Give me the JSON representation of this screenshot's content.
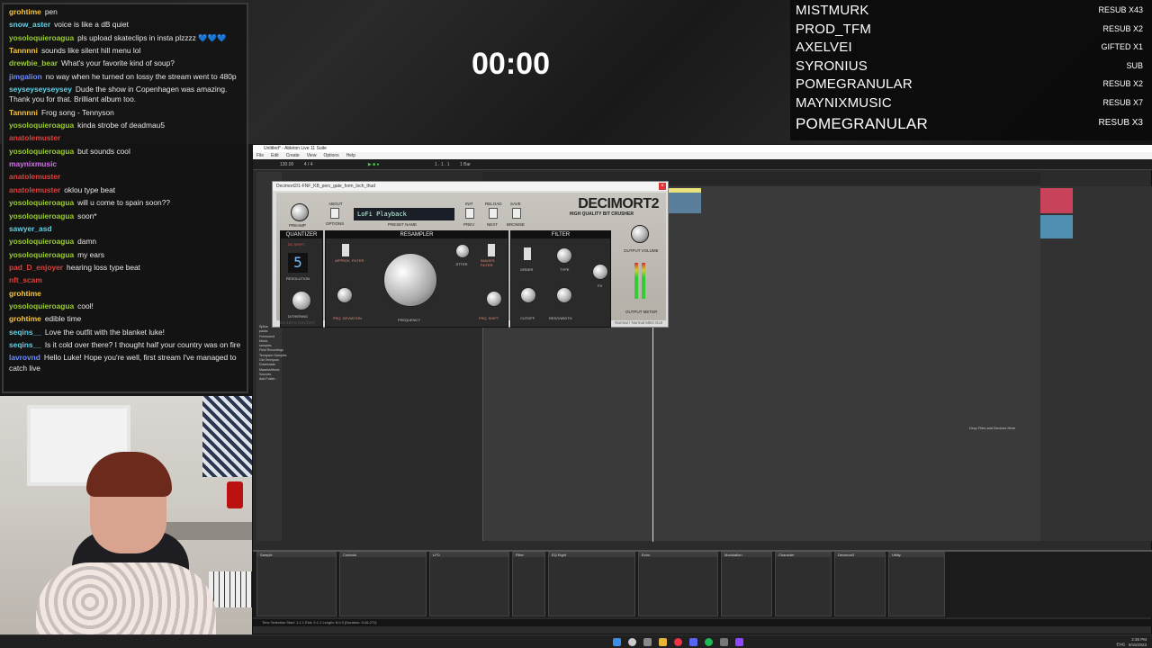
{
  "chat": {
    "messages": [
      {
        "user": "grohtime",
        "text": "pen",
        "color": "#f4c542"
      },
      {
        "user": "snow_aster",
        "text": "voice is like a dB quiet",
        "color": "#5fd3e8"
      },
      {
        "user": "yosoloquieroagua",
        "text": "pls upload skateclips in insta plzzzz 💙💙💙",
        "color": "#9acd32"
      },
      {
        "user": "Tannnni",
        "text": "sounds like silent hill menu lol",
        "color": "#f4c542"
      },
      {
        "user": "drewbie_bear",
        "text": "What's your favorite kind of soup?",
        "color": "#9acd32"
      },
      {
        "user": "jimgalion",
        "text": "no way when he turned on lossy the stream went to 480p",
        "color": "#6b8cff"
      },
      {
        "user": "seyseyseyseysey",
        "text": "Dude the show in Copenhagen was amazing. Thank you for that. Brilliant album too.",
        "color": "#5fd3e8"
      },
      {
        "user": "Tannnni",
        "text": "Frog song - Tennyson",
        "color": "#f4c542"
      },
      {
        "user": "yosoloquieroagua",
        "text": "kinda strobe of deadmau5",
        "color": "#9acd32"
      },
      {
        "user": "anatolemuster",
        "text": "",
        "color": "#e0403a"
      },
      {
        "user": "yosoloquieroagua",
        "text": "but sounds cool",
        "color": "#9acd32"
      },
      {
        "user": "maynixmusic",
        "text": "",
        "color": "#d870f0"
      },
      {
        "user": "anatolemuster",
        "text": "",
        "color": "#e0403a"
      },
      {
        "user": "anatolemuster",
        "text": "oklou type beat",
        "color": "#e0403a"
      },
      {
        "user": "yosoloquieroagua",
        "text": "will u come to spain soon??",
        "color": "#9acd32"
      },
      {
        "user": "yosoloquieroagua",
        "text": "soon*",
        "color": "#9acd32"
      },
      {
        "user": "sawyer_asd",
        "text": "",
        "color": "#5fd3e8"
      },
      {
        "user": "yosoloquieroagua",
        "text": "damn",
        "color": "#9acd32"
      },
      {
        "user": "yosoloquieroagua",
        "text": "my ears",
        "color": "#9acd32"
      },
      {
        "user": "pad_D_enjoyer",
        "text": "hearing loss type beat",
        "color": "#e0403a"
      },
      {
        "user": "nft_scam",
        "text": "",
        "color": "#e0403a"
      },
      {
        "user": "grohtime",
        "text": "",
        "color": "#f4c542"
      },
      {
        "user": "yosoloquieroagua",
        "text": "cool!",
        "color": "#9acd32"
      },
      {
        "user": "grohtime",
        "text": "edible time",
        "color": "#f4c542"
      },
      {
        "user": "seqins__",
        "text": "Love the outfit with the blanket luke!",
        "color": "#5fd3e8"
      },
      {
        "user": "seqins__",
        "text": "Is it cold over there? I thought half your country was on fire",
        "color": "#5fd3e8"
      },
      {
        "user": "lavrovnd",
        "text": "Hello Luke! Hope you're well, first stream I've managed to catch live",
        "color": "#6b8cff"
      }
    ]
  },
  "timer": {
    "value": "00:00"
  },
  "subs": {
    "rows": [
      {
        "name": "MISTMURK",
        "tag": "RESUB X43"
      },
      {
        "name": "PROD_TFM",
        "tag": "RESUB X2"
      },
      {
        "name": "AXELVEI",
        "tag": "GIFTED X1"
      },
      {
        "name": "SYRONIUS",
        "tag": "SUB"
      },
      {
        "name": "POMEGRANULAR",
        "tag": "RESUB X2"
      },
      {
        "name": "MAYNIXMUSIC",
        "tag": "RESUB X7"
      }
    ],
    "latest": {
      "name": "POMEGRANULAR",
      "tag": "RESUB X3"
    }
  },
  "daw": {
    "title": "Untitled* - Ableton Live 11 Suite",
    "menu": [
      "File",
      "Edit",
      "Create",
      "View",
      "Options",
      "Help"
    ],
    "transport": {
      "tempo": "130.00",
      "sig": "4 / 4",
      "position": "1 . 1 . 1",
      "bar": "1 Bar"
    },
    "places": [
      "Splice",
      "packs",
      "Freesound",
      "Music",
      "samples",
      "Field Recordings",
      "Tennyson Samples",
      "Old Tennyson",
      "Downloads",
      "MassiveMusic",
      "Sources",
      "Add Folder..."
    ],
    "drop_text": "Drop Files and Devices Here",
    "devices": [
      "Sample",
      "Controls",
      "LFO",
      "Filter",
      "EQ Eight",
      "Echo",
      "Modulation",
      "Character",
      "Decimort2",
      "Utility"
    ],
    "status": "Time Selection   Start: 1.1.1   End: 9.1.1   Length: 8.0.0 (Duration: 0:16.271)",
    "clip_name": "1-FNF_KB_perc_gate_form_loch_thud"
  },
  "plugin": {
    "titlebar": "Decimort2/1-FNF_KB_perc_gate_form_loch_thud",
    "logo": "DECIMORT2",
    "subtitle": "HIGH QUALITY BIT CRUSHER",
    "preset_label": "PRESET NAME",
    "preset": "LoFi Playback",
    "buttons": [
      "ABOUT",
      "OPTIONS",
      "INIT",
      "PREV",
      "RELOAD",
      "NEXT",
      "SAVE",
      "BROWSE"
    ],
    "sections": {
      "quantizer": "QUANTIZER",
      "resampler": "RESAMPLER",
      "filter": "FILTER"
    },
    "labels": {
      "preamp": "PREAMP",
      "dc_shift": "DC SHIFT",
      "resolution": "RESOLUTION",
      "resolution_value": "5",
      "dithering": "DITHERING",
      "freq_deviation": "FRQ. DEVIATION",
      "approx_filter": "APPROX. FILTER",
      "frequency": "FREQUENCY",
      "jitter": "JITTER",
      "images_filter": "IMAGES FILTER",
      "frq_shift": "FRQ. SHIFT",
      "order": "ORDER",
      "type": "TYPE",
      "cutoff": "CUTOFF",
      "reso_width": "RESO/WIDTH",
      "fx": "FX",
      "output_volume": "OUTPUT VOLUME",
      "output_meter": "OUTPUT METER"
    },
    "footer_left": "On 100% (Dry/Wet)",
    "footer_right": "Normal / Normal   MIDI   GUI"
  },
  "tray": {
    "time": "2:36 PM",
    "date": "8/15/2023",
    "lang": "ENG"
  }
}
